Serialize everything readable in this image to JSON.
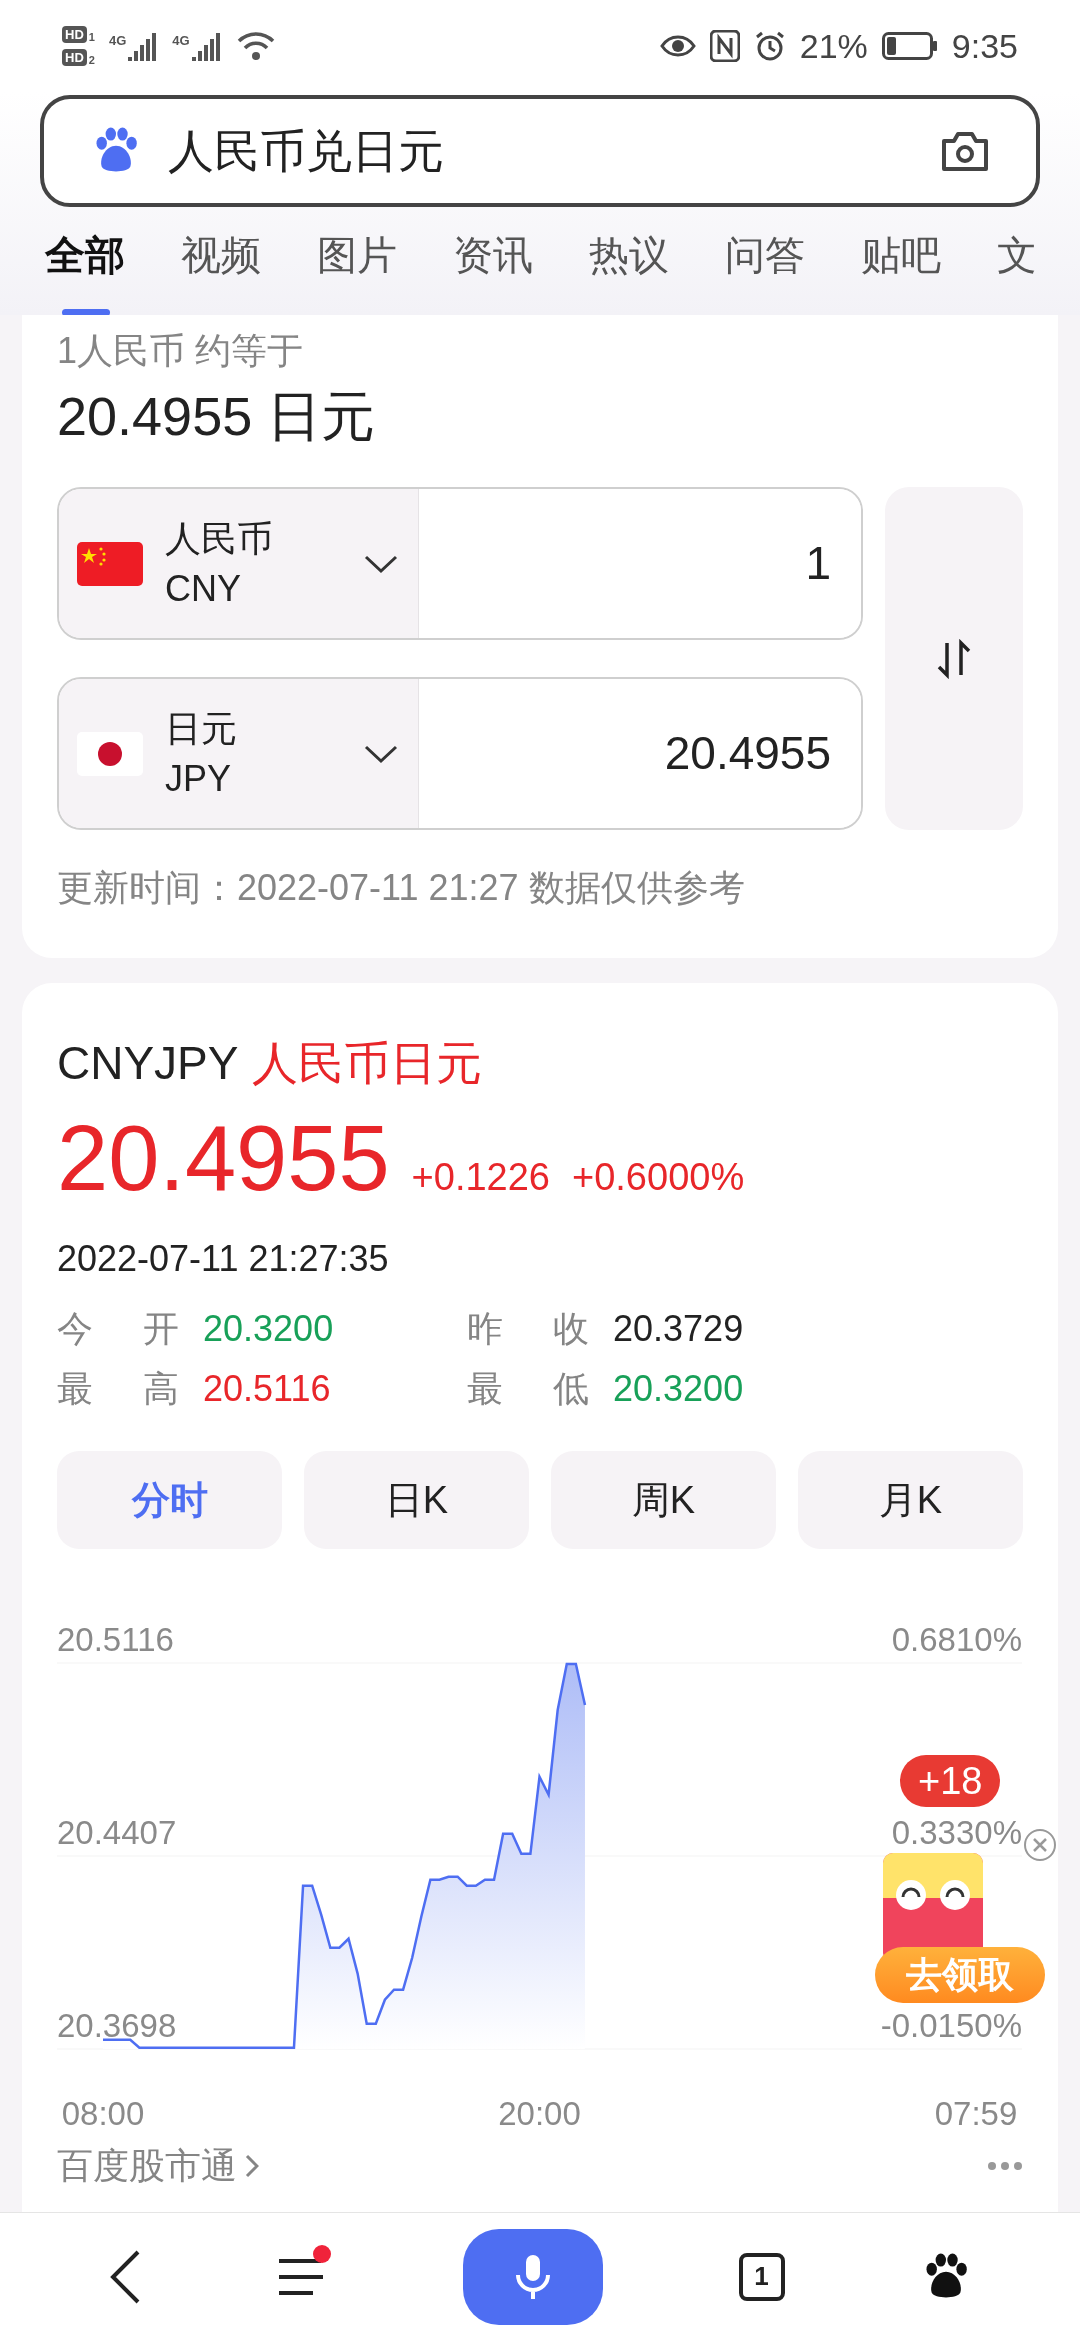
{
  "status_bar": {
    "hd_badges": [
      {
        "label": "HD",
        "slot": "1"
      },
      {
        "label": "HD",
        "slot": "2"
      }
    ],
    "network_labels": [
      "4G",
      "4G"
    ],
    "battery_text": "21%",
    "time": "9:35"
  },
  "search": {
    "query": "人民币兑日元"
  },
  "tabs": [
    {
      "label": "全部",
      "selected": true
    },
    {
      "label": "视频",
      "selected": false
    },
    {
      "label": "图片",
      "selected": false
    },
    {
      "label": "资讯",
      "selected": false
    },
    {
      "label": "热议",
      "selected": false
    },
    {
      "label": "问答",
      "selected": false
    },
    {
      "label": "贴吧",
      "selected": false
    },
    {
      "label": "文",
      "selected": false
    }
  ],
  "converter": {
    "caption": "1人民币 约等于",
    "result": "20.4955 日元",
    "rows": [
      {
        "kind": "cn",
        "name": "人民币",
        "code": "CNY",
        "amount": "1"
      },
      {
        "kind": "jp",
        "name": "日元",
        "code": "JPY",
        "amount": "20.4955"
      }
    ],
    "update_note": "更新时间：2022-07-11 21:27 数据仅供参考"
  },
  "quote": {
    "symbol": "CNYJPY",
    "name": "人民币日元",
    "price": "20.4955",
    "change": "+0.1226",
    "change_pct": "+0.6000%",
    "timestamp": "2022-07-11 21:27:35",
    "stats": [
      {
        "label": "今 开",
        "value": "20.3200",
        "color": "#18a058"
      },
      {
        "label": "昨 收",
        "value": "20.3729",
        "color": "#222222"
      },
      {
        "label": "最 高",
        "value": "20.5116",
        "color": "#e8262a"
      },
      {
        "label": "最 低",
        "value": "20.3200",
        "color": "#18a058"
      }
    ],
    "periods": [
      {
        "label": "分时",
        "selected": true
      },
      {
        "label": "日K",
        "selected": false
      },
      {
        "label": "周K",
        "selected": false
      },
      {
        "label": "月K",
        "selected": false
      }
    ],
    "percent_labels": [
      "0.6810%",
      "0.3330%",
      "-0.0150%"
    ],
    "chart_data": {
      "type": "area",
      "ylim": [
        20.3698,
        20.5116
      ],
      "categories": [
        "08:00",
        null,
        null,
        null,
        null,
        null,
        null,
        null,
        null,
        null,
        null,
        null,
        null,
        null,
        null,
        null,
        null,
        null,
        null,
        null,
        null,
        null,
        null,
        null,
        null,
        null,
        null,
        null,
        null,
        null,
        null,
        null,
        null,
        null,
        null,
        null,
        null,
        null,
        null,
        null,
        null,
        null,
        null,
        null,
        null,
        null,
        null,
        null,
        "20:00",
        null,
        null,
        null,
        null,
        null,
        null,
        null,
        null,
        null,
        null,
        null,
        null,
        null,
        null,
        null,
        null,
        null,
        null,
        null,
        null,
        null,
        null,
        null,
        null,
        null,
        null,
        null,
        null,
        null,
        null,
        null,
        null,
        null,
        null,
        null,
        null,
        null,
        null,
        null,
        null,
        null,
        null,
        null,
        null,
        null,
        null,
        null,
        "07:59"
      ],
      "yticks": [
        {
          "value": 20.5116,
          "label": "20.5116"
        },
        {
          "value": 20.4407,
          "label": "20.4407"
        },
        {
          "value": 20.3698,
          "label": "20.3698"
        }
      ],
      "series": [
        {
          "color": "#4e6ef2",
          "values": [
            20.3732,
            20.3732,
            20.3732,
            20.3732,
            20.3703,
            20.3703,
            20.3703,
            20.3703,
            20.3703,
            20.3703,
            20.3703,
            20.3703,
            20.3703,
            20.3703,
            20.3703,
            20.3703,
            20.3703,
            20.3703,
            20.3703,
            20.3703,
            20.3703,
            20.3703,
            20.4298,
            20.4298,
            20.4191,
            20.407,
            20.407,
            20.4103,
            20.3975,
            20.3791,
            20.3791,
            20.3879,
            20.3916,
            20.3916,
            20.4033,
            20.4184,
            20.432,
            20.432,
            20.4331,
            20.4331,
            20.4298,
            20.4298,
            20.432,
            20.432,
            20.4489,
            20.4489,
            20.4415,
            20.4415,
            20.4698,
            20.4632,
            20.4944,
            20.5112,
            20.5112,
            20.4962,
            null,
            null,
            null,
            null,
            null,
            null,
            null,
            null,
            null,
            null,
            null,
            null,
            null,
            null,
            null,
            null,
            null,
            null,
            null,
            null,
            null,
            null,
            null,
            null,
            null,
            null,
            null,
            null,
            null,
            null,
            null,
            null,
            null,
            null,
            null,
            null,
            null,
            null,
            null,
            null,
            null,
            null,
            null
          ]
        }
      ]
    },
    "footer_link": "百度股市通"
  },
  "promo": {
    "badge": "+18",
    "button": "去领取"
  },
  "bottom_nav": {
    "tab_count": "1",
    "menu_unread": true
  }
}
